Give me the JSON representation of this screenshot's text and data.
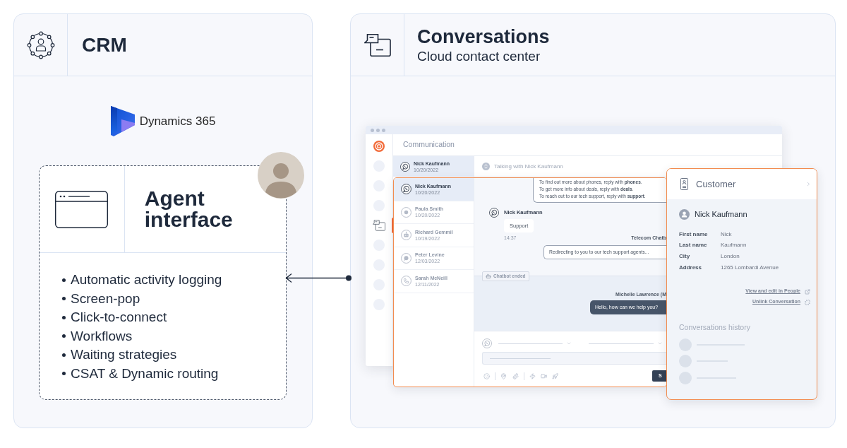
{
  "crm": {
    "title": "CRM",
    "logo_text": "Dynamics 365",
    "agent_card": {
      "title": "Agent interface",
      "features": [
        "Automatic activity logging",
        "Screen-pop",
        "Click-to-connect",
        "Workflows",
        "Waiting strategies",
        "CSAT & Dynamic routing"
      ]
    }
  },
  "conversations": {
    "title": "Conversations",
    "subtitle": "Cloud contact center"
  },
  "app_window": {
    "rail": [
      {
        "kind": "logo",
        "selected": false
      },
      {
        "kind": "placeholder",
        "selected": false
      },
      {
        "kind": "placeholder",
        "selected": false
      },
      {
        "kind": "placeholder",
        "selected": false
      },
      {
        "kind": "conversations",
        "selected": true
      },
      {
        "kind": "placeholder",
        "selected": false
      },
      {
        "kind": "placeholder",
        "selected": false
      },
      {
        "kind": "placeholder",
        "selected": false
      },
      {
        "kind": "placeholder",
        "selected": false
      }
    ],
    "header": "Communication",
    "list": [
      {
        "name": "Nick Kaufmann",
        "date": "10/20/2022",
        "selected": true
      }
    ],
    "chat_header": "Talking with Nick Kaufmann"
  },
  "chat_window": {
    "contacts": [
      {
        "kind": "phone",
        "name": "Nick Kaufmann",
        "date": "10/20/2022",
        "selected": true
      },
      {
        "kind": "dot",
        "name": "Paula Smith",
        "date": "10/20/2022",
        "selected": false
      },
      {
        "kind": "bot",
        "name": "Richard Gemmil",
        "date": "10/19/2022",
        "selected": false
      },
      {
        "kind": "chat",
        "name": "Peter Levine",
        "date": "12/03/2022",
        "selected": false
      },
      {
        "kind": "call",
        "name": "Sarah McNeill",
        "date": "12/11/2022",
        "selected": false
      }
    ],
    "messages": [
      {
        "kind": "menu",
        "lines": [
          "To find out more about phones, reply with **phones**.",
          "To get more info about deals, reply with **deals**.",
          "To reach out to our tech support, reply with **support**."
        ]
      },
      {
        "kind": "customer",
        "sender": "Nick Kaufmann",
        "text": "Support",
        "time": "14:37"
      },
      {
        "kind": "bot",
        "sender": "Telecom Chatb",
        "text": "Redirecting to you to our tech support agents..."
      },
      {
        "kind": "event",
        "text": "Chatbot ended"
      },
      {
        "kind": "agent",
        "sender": "Michelle Lawrence (M",
        "text": "Hello, how can we help you?"
      }
    ],
    "send_label": "S"
  },
  "customer_card": {
    "title": "Customer",
    "name": "Nick Kaufmann",
    "fields": [
      {
        "label": "First name",
        "value": "Nick"
      },
      {
        "label": "Last name",
        "value": "Kaufmann"
      },
      {
        "label": "City",
        "value": "London"
      },
      {
        "label": "Address",
        "value": "1265 Lombardi Avenue"
      }
    ],
    "links": [
      {
        "kind": "external",
        "text": "View and edit in People"
      },
      {
        "kind": "unlink",
        "text": "Unlink Conversation"
      }
    ],
    "history_title": "Conversations history"
  }
}
